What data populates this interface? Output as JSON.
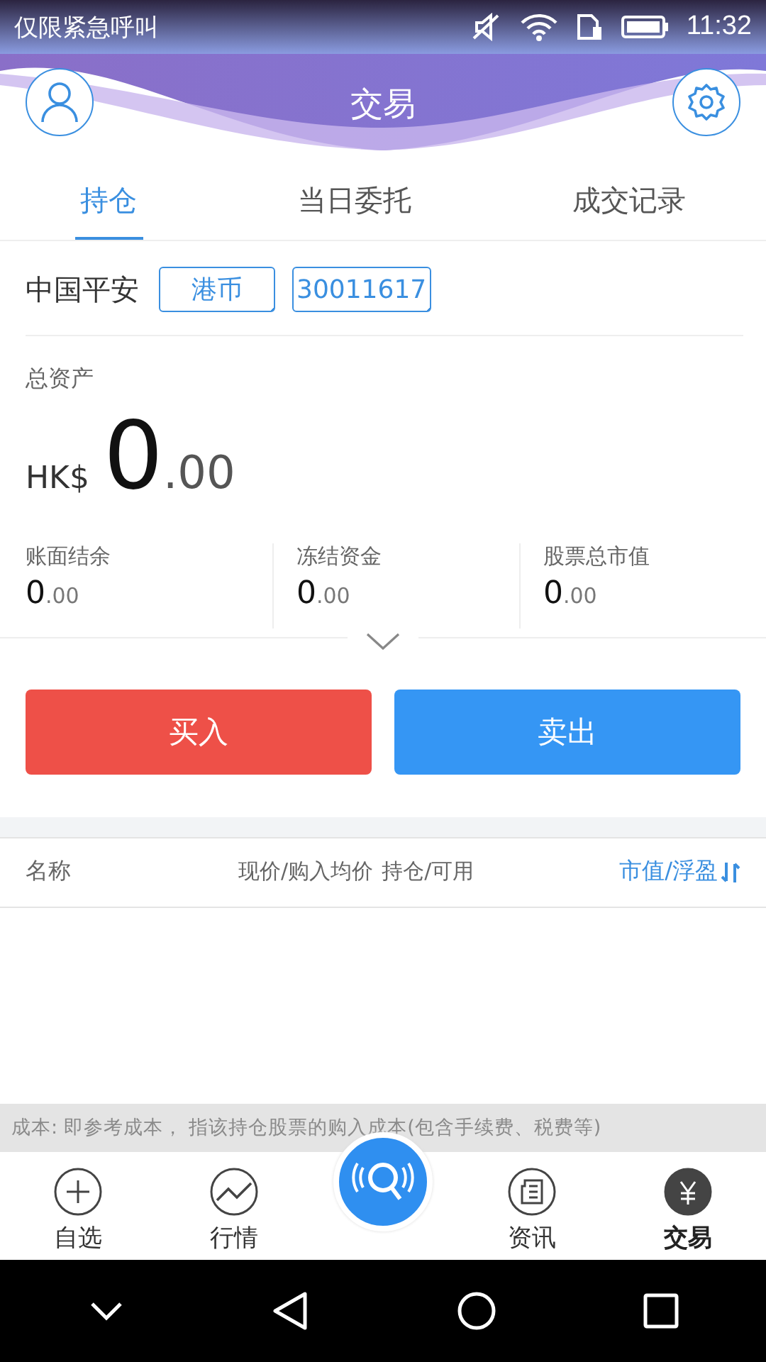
{
  "status_bar": {
    "carrier": "仅限紧急呼叫",
    "time": "11:32"
  },
  "header": {
    "title": "交易"
  },
  "tabs": [
    {
      "label": "持仓",
      "selected": true
    },
    {
      "label": "当日委托",
      "selected": false
    },
    {
      "label": "成交记录",
      "selected": false
    }
  ],
  "account": {
    "name": "中国平安",
    "currency": "港币",
    "number": "30011617"
  },
  "total": {
    "label": "总资产",
    "prefix": "HK$",
    "integer": "0",
    "decimals": ".00"
  },
  "stats": [
    {
      "label": "账面结余",
      "integer": "0",
      "decimals": ".00"
    },
    {
      "label": "冻结资金",
      "integer": "0",
      "decimals": ".00"
    },
    {
      "label": "股票总市值",
      "integer": "0",
      "decimals": ".00"
    }
  ],
  "actions": {
    "buy": "买入",
    "sell": "卖出"
  },
  "table": {
    "columns": [
      "名称",
      "现价/购入均价",
      "持仓/可用",
      "市值/浮盈"
    ]
  },
  "note": "成本: 即参考成本， 指该持仓股票的购入成本(包含手续费、税费等)",
  "nav": [
    {
      "label": "自选",
      "selected": false
    },
    {
      "label": "行情",
      "selected": false
    },
    {
      "label": "资讯",
      "selected": false
    },
    {
      "label": "交易",
      "selected": true
    }
  ]
}
